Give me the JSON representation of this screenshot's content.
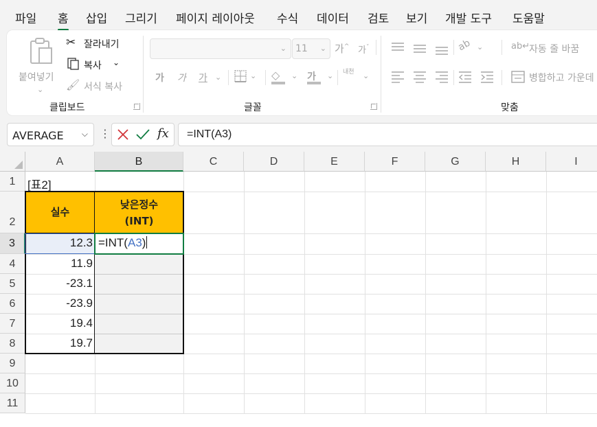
{
  "tabs": [
    {
      "label": "파일",
      "active": false
    },
    {
      "label": "홈",
      "active": true
    },
    {
      "label": "삽입",
      "active": false
    },
    {
      "label": "그리기",
      "active": false
    },
    {
      "label": "페이지 레이아웃",
      "active": false
    },
    {
      "label": "수식",
      "active": false
    },
    {
      "label": "데이터",
      "active": false
    },
    {
      "label": "검토",
      "active": false
    },
    {
      "label": "보기",
      "active": false
    },
    {
      "label": "개발 도구",
      "active": false
    },
    {
      "label": "도움말",
      "active": false
    }
  ],
  "ribbon": {
    "clipboard": {
      "paste": "붙여넣기",
      "cut": "잘라내기",
      "copy": "복사",
      "format_painter": "서식 복사",
      "group_label": "클립보드"
    },
    "font": {
      "font_name": "",
      "font_size": "11",
      "grow": "가",
      "shrink": "가",
      "bold": "가",
      "italic": "가",
      "underline": "가",
      "font_color": "가",
      "phonetic": "내천",
      "group_label": "글꼴"
    },
    "alignment": {
      "wrap_text": "자동 줄 바꿈",
      "merge_center": "병합하고 가운데",
      "group_label": "맞춤"
    }
  },
  "formula_bar": {
    "name_box": "AVERAGE",
    "fx": "fx",
    "formula": "=INT(A3)"
  },
  "sheet": {
    "columns": [
      "A",
      "B",
      "C",
      "D",
      "E",
      "F",
      "G",
      "H",
      "I"
    ],
    "rows": [
      "1",
      "2",
      "3",
      "4",
      "5",
      "6",
      "7",
      "8",
      "9",
      "10",
      "11"
    ],
    "title_cell": "[표2]",
    "header_a": "실수",
    "header_b_line1": "낮은정수",
    "header_b_line2": "(INT)",
    "editing_prefix": "=INT(",
    "editing_ref": "A3",
    "editing_suffix": ")",
    "values": [
      "12.3",
      "11.9",
      "-23.1",
      "-23.9",
      "19.4",
      "19.7"
    ]
  },
  "colors": {
    "accent": "#107c41",
    "header_fill": "#ffc000",
    "reference_blue": "#4472c4",
    "cancel_red": "#d13438"
  }
}
